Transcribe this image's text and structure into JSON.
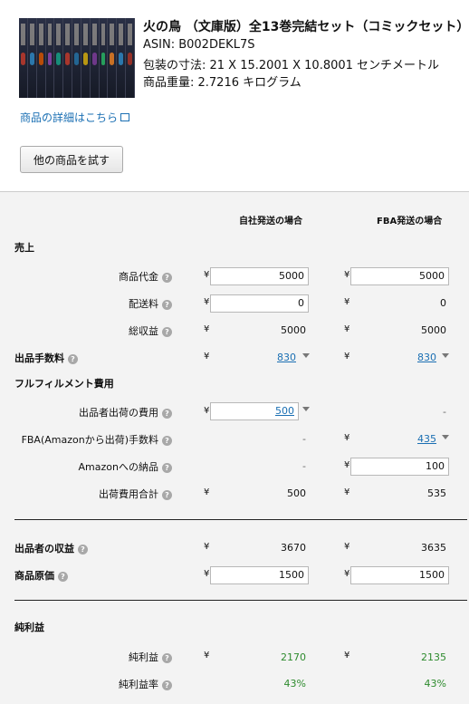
{
  "product": {
    "title": "火の鳥 （文庫版）全13巻完結セット（コミックセット）",
    "asin": "ASIN: B002DEKL7S",
    "dimensions": "包装の寸法: 21 X 15.2001 X 10.8001 センチメートル",
    "weight": "商品重量: 2.7216 キログラム",
    "detail_link": "商品の詳細はこちら",
    "try_other_button": "他の商品を試す",
    "cover_icon": "book-set-cover-image"
  },
  "calc": {
    "col_self": "自社発送の場合",
    "col_fba": "FBA発送の場合",
    "currency": "¥",
    "help_glyph": "?",
    "sections": {
      "sales": "売上",
      "fulfillment": "フルフィルメント費用",
      "net": "純利益"
    },
    "rows": {
      "item_price": {
        "label": "商品代金",
        "self": "5000",
        "fba": "5000"
      },
      "shipping": {
        "label": "配送料",
        "self": "0",
        "fba": "0"
      },
      "gross": {
        "label": "総収益",
        "self": "5000",
        "fba": "5000"
      },
      "selling_fee": {
        "label": "出品手数料",
        "self": "830",
        "fba": "830"
      },
      "seller_shipping": {
        "label": "出品者出荷の費用",
        "self": "500",
        "fba": "-"
      },
      "fba_fee": {
        "label": "FBA(Amazonから出荷)手数料",
        "self": "-",
        "fba": "435"
      },
      "inbound": {
        "label": "Amazonへの納品",
        "self": "-",
        "fba": "100"
      },
      "ship_total": {
        "label": "出荷費用合計",
        "self": "500",
        "fba": "535"
      },
      "seller_proceeds": {
        "label": "出品者の収益",
        "self": "3670",
        "fba": "3635"
      },
      "cost": {
        "label": "商品原価",
        "self": "1500",
        "fba": "1500"
      },
      "net_profit": {
        "label": "純利益",
        "self": "2170",
        "fba": "2135"
      },
      "net_margin": {
        "label": "純利益率",
        "self": "43%",
        "fba": "43%"
      }
    },
    "colors": {
      "link": "#1a6fb3",
      "profit": "#2e8b2e"
    }
  }
}
